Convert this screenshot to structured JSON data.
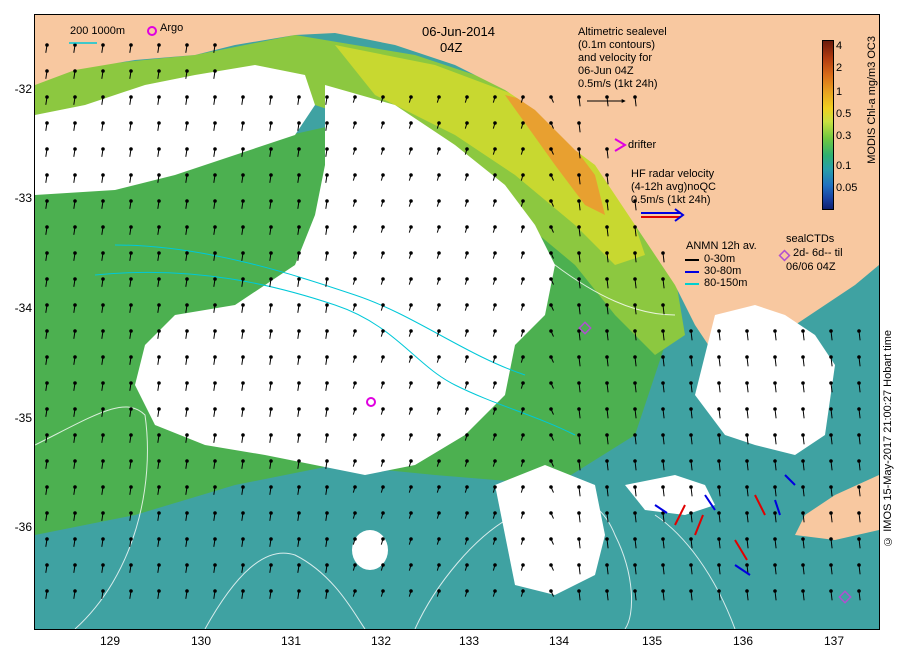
{
  "map": {
    "date": "06-Jun-2014",
    "time": "04Z",
    "y_ticks": [
      "-32",
      "-33",
      "-34",
      "-35",
      "-36"
    ],
    "x_ticks": [
      "129",
      "130",
      "131",
      "132",
      "133",
      "134",
      "135",
      "136",
      "137"
    ],
    "lon_range": [
      128.2,
      137.5
    ],
    "lat_range": [
      -36.9,
      -31.3
    ]
  },
  "legend": {
    "isobaths": "200  1000m",
    "argo": "Argo",
    "altimetric_lines": [
      "Altimetric sealevel",
      "(0.1m contours)",
      "and velocity for",
      "06-Jun 04Z",
      "0.5m/s (1kt 24h)"
    ],
    "drifter": "drifter",
    "hf_lines": [
      "HF radar velocity",
      "(4-12h avg)noQC",
      "0.5m/s (1kt 24h)"
    ],
    "anmn_title": "ANMN 12h av.",
    "anmn_items": [
      {
        "label": "0-30m",
        "color": "#000000"
      },
      {
        "label": "30-80m",
        "color": "#0000e0"
      },
      {
        "label": "80-150m",
        "color": "#00d0d0"
      }
    ],
    "seal_lines": [
      "sealCTDs",
      "2d- 6d-- til",
      "06/06 04Z"
    ]
  },
  "colorbar": {
    "ticks": [
      "4",
      "2",
      "1",
      "0.5",
      "0.3",
      "0.1",
      "0.05"
    ],
    "title": "MODIS Chl-a mg/m3 OC3"
  },
  "credit": "© IMOS 15-May-2017 21:00:27 Hobart time",
  "colors": {
    "land": "#f8c8a0",
    "cloud": "#ffffff",
    "ocean_teal": "#3fa2a2",
    "ocean_green": "#4cb050",
    "coastal_yellow": "#e0d030",
    "argo": "#e000e0",
    "hf_red": "#e00000",
    "hf_blue": "#0000e0"
  }
}
